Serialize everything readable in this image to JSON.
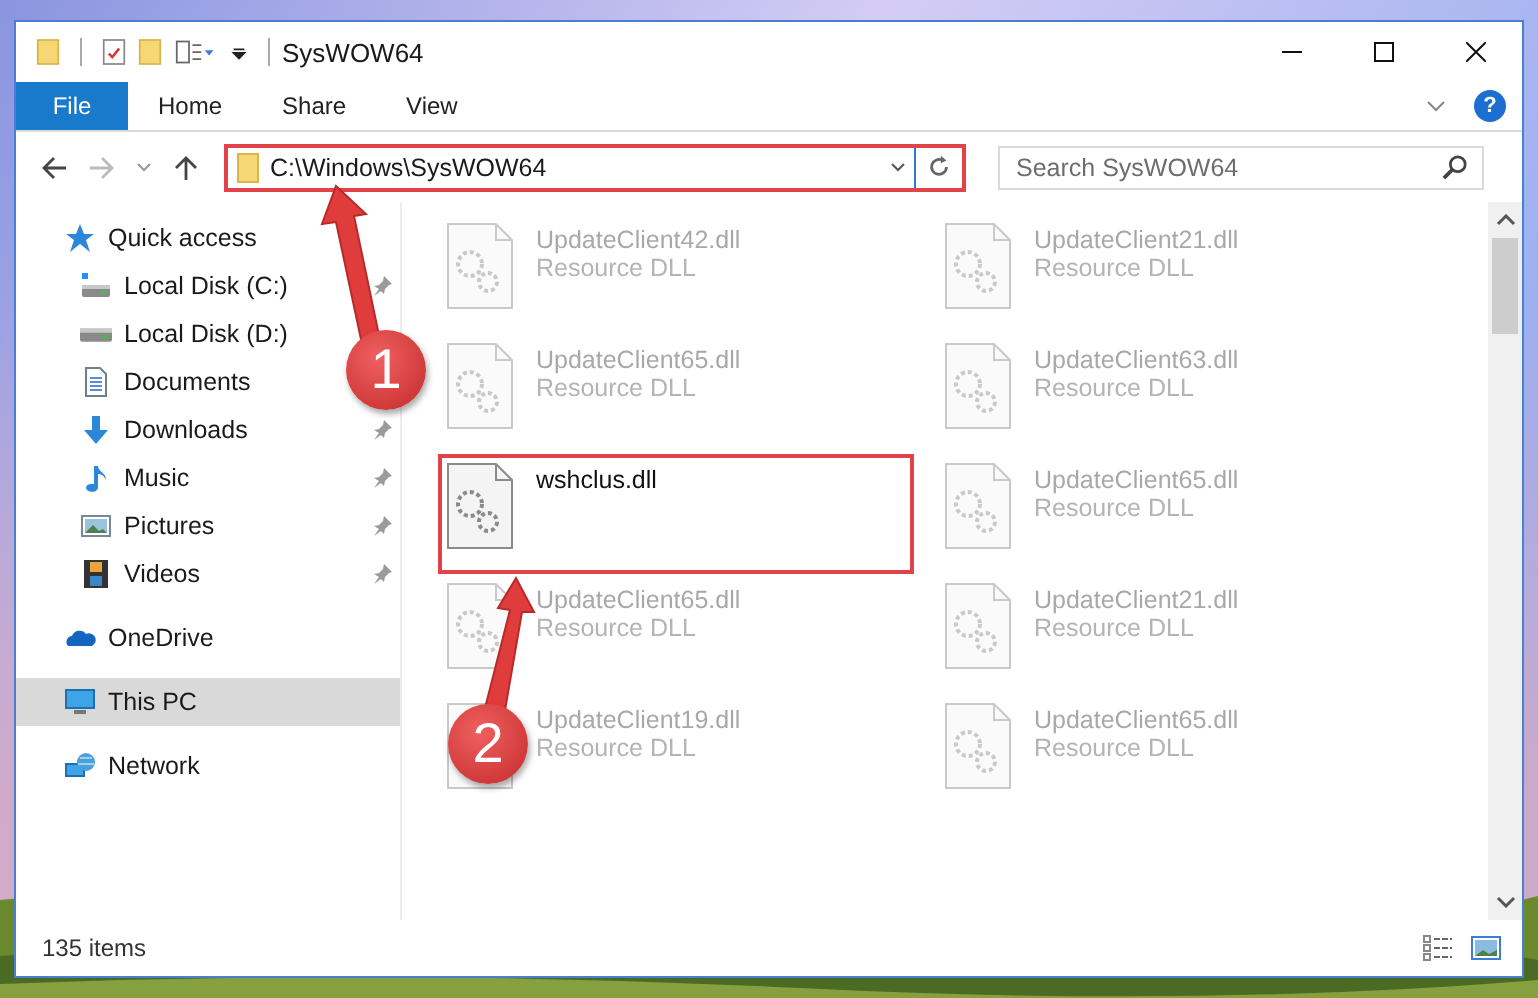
{
  "window": {
    "title": "SysWOW64"
  },
  "ribbon": {
    "file_label": "File",
    "tabs": [
      {
        "label": "Home"
      },
      {
        "label": "Share"
      },
      {
        "label": "View"
      }
    ],
    "help_label": "?"
  },
  "address_bar": {
    "path": "C:\\Windows\\SysWOW64",
    "highlighted": true
  },
  "search": {
    "placeholder": "Search SysWOW64"
  },
  "sidebar": {
    "items": [
      {
        "kind": "quick-access",
        "label": "Quick access",
        "selected": false,
        "children": [
          {
            "kind": "drive-windows",
            "label": "Local Disk (C:)",
            "pinned": true,
            "selected": false
          },
          {
            "kind": "drive",
            "label": "Local Disk (D:)",
            "pinned": false,
            "selected": false
          },
          {
            "kind": "documents",
            "label": "Documents",
            "pinned": false,
            "selected": false
          },
          {
            "kind": "downloads",
            "label": "Downloads",
            "pinned": true,
            "selected": false
          },
          {
            "kind": "music",
            "label": "Music",
            "pinned": true,
            "selected": false
          },
          {
            "kind": "pictures",
            "label": "Pictures",
            "pinned": true,
            "selected": false
          },
          {
            "kind": "videos",
            "label": "Videos",
            "pinned": true,
            "selected": false
          }
        ]
      },
      {
        "kind": "onedrive",
        "label": "OneDrive",
        "selected": false
      },
      {
        "kind": "pc",
        "label": "This PC",
        "selected": true
      },
      {
        "kind": "network",
        "label": "Network",
        "selected": false
      }
    ]
  },
  "files": [
    {
      "name": "UpdateClient42.dll",
      "type": "Resource DLL",
      "dimmed": true,
      "highlighted": false
    },
    {
      "name": "UpdateClient21.dll",
      "type": "Resource DLL",
      "dimmed": true,
      "highlighted": false
    },
    {
      "name": "UpdateClient65.dll",
      "type": "Resource DLL",
      "dimmed": true,
      "highlighted": false
    },
    {
      "name": "UpdateClient63.dll",
      "type": "Resource DLL",
      "dimmed": true,
      "highlighted": false
    },
    {
      "name": "wshclus.dll",
      "dimmed": false,
      "highlighted": true
    },
    {
      "name": "UpdateClient65.dll",
      "type": "Resource DLL",
      "dimmed": true,
      "highlighted": false
    },
    {
      "name": "UpdateClient65.dll",
      "type": "Resource DLL",
      "dimmed": true,
      "highlighted": false
    },
    {
      "name": "UpdateClient21.dll",
      "type": "Resource DLL",
      "dimmed": true,
      "highlighted": false
    },
    {
      "name": "UpdateClient19.dll",
      "type": "Resource DLL",
      "dimmed": true,
      "highlighted": false
    },
    {
      "name": "UpdateClient65.dll",
      "type": "Resource DLL",
      "dimmed": true,
      "highlighted": false
    }
  ],
  "annotations": [
    {
      "label": "1"
    },
    {
      "label": "2"
    }
  ],
  "status_bar": {
    "item_count": "135 items"
  }
}
